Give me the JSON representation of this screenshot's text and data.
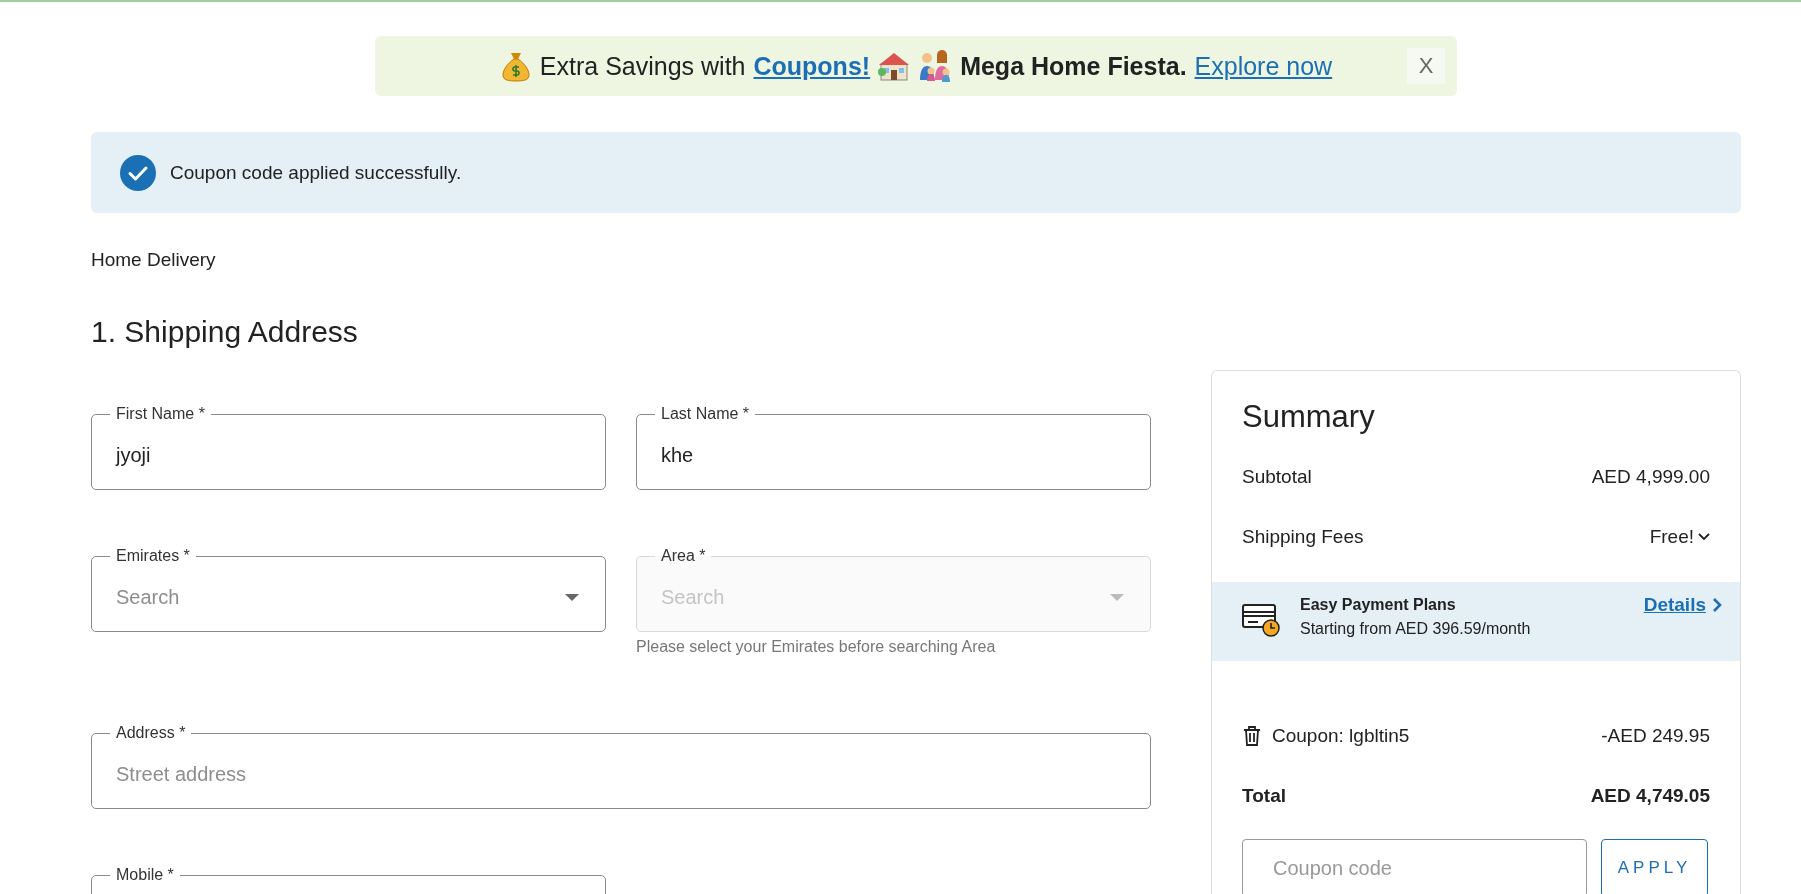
{
  "banner": {
    "lead": "Extra Savings with",
    "coupon_link": "Coupons!",
    "promo": "Mega Home Fiesta.",
    "explore_link": "Explore now",
    "close": "X"
  },
  "alert": {
    "message": "Coupon code applied successfully."
  },
  "delivery_method": "Home Delivery",
  "section_title": "1. Shipping Address",
  "form_rows": [
    {
      "fields": [
        {
          "kind": "text",
          "label": "First Name *",
          "value": "jyoji",
          "disabled": false
        },
        {
          "kind": "text",
          "label": "Last Name *",
          "value": "khe",
          "disabled": false
        }
      ]
    },
    {
      "fields": [
        {
          "kind": "select",
          "label": "Emirates *",
          "placeholder": "Search",
          "disabled": false
        },
        {
          "kind": "select",
          "label": "Area *",
          "placeholder": "Search",
          "disabled": true,
          "helper": "Please select your Emirates before searching Area"
        }
      ]
    },
    {
      "fields": [
        {
          "kind": "text",
          "label": "Address *",
          "placeholder": "Street address",
          "disabled": false,
          "full_width": true
        }
      ]
    },
    {
      "fields": [
        {
          "kind": "text",
          "label": "Mobile *",
          "disabled": false
        }
      ]
    }
  ],
  "summary": {
    "title": "Summary",
    "lines": [
      {
        "kind": "plain",
        "label": "Subtotal",
        "value": "AED 4,999.00"
      },
      {
        "kind": "dropdown",
        "label": "Shipping Fees",
        "value": "Free!"
      }
    ],
    "payment_plan": {
      "title": "Easy Payment Plans",
      "subtitle": "Starting from AED 396.59/month",
      "link": "Details"
    },
    "coupon": {
      "label": "Coupon: lgbltin5",
      "amount": "-AED 249.95"
    },
    "total": {
      "label": "Total",
      "value": "AED 4,749.05"
    },
    "coupon_input": {
      "placeholder": "Coupon code"
    },
    "apply_button": "APPLY"
  }
}
